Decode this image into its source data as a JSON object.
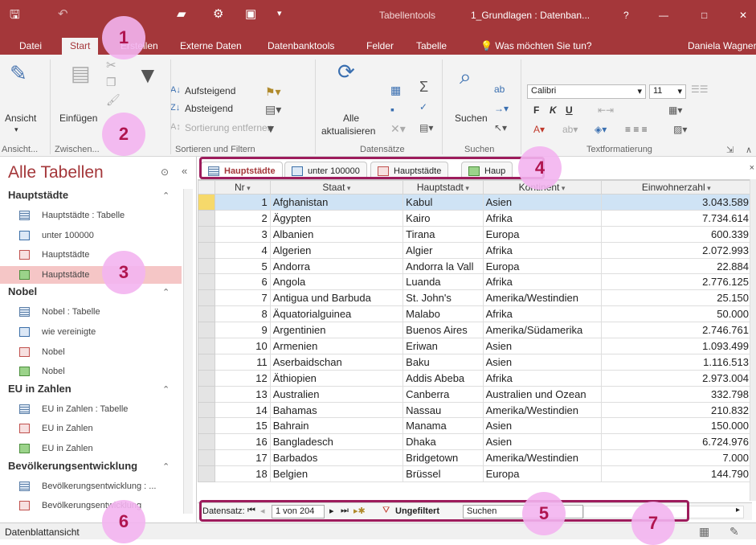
{
  "titlebar": {
    "context_tab": "Tabellentools",
    "doc_title": "1_Grundlagen : Datenban...",
    "help": "?",
    "minimize": "—",
    "maximize": "□",
    "close": "✕"
  },
  "tabs": [
    "Datei",
    "Start",
    "Erstellen",
    "Externe Daten",
    "Datenbanktools",
    "Felder",
    "Tabelle"
  ],
  "tellme": "Was möchten Sie tun?",
  "user": "Daniela Wagner",
  "ribbon": {
    "ansicht": "Ansicht",
    "einfuegen": "Einfügen",
    "aufsteigend": "Aufsteigend",
    "absteigend": "Absteigend",
    "sortierung_entfernen": "Sortierung entfernen",
    "alle": "Alle",
    "aktualisieren": "aktualisieren",
    "suchen": "Suchen",
    "font": "Calibri",
    "font_size": "11",
    "bold": "F",
    "italic": "K",
    "underline": "U",
    "groups": {
      "ansicht": "Ansicht...",
      "zwischen": "Zwischen...",
      "sortieren": "Sortieren und Filtern",
      "datensaetze": "Datensätze",
      "suchen": "Suchen",
      "text": "Textformatierung"
    }
  },
  "nav": {
    "title": "Alle Tabellen",
    "groups": [
      {
        "name": "Hauptstädte",
        "items": [
          {
            "label": "Hauptstädte : Tabelle",
            "icon": "table-icon"
          },
          {
            "label": "unter 100000",
            "icon": "query-icon"
          },
          {
            "label": "Hauptstädte",
            "icon": "form-icon"
          },
          {
            "label": "Hauptstädte",
            "icon": "report-icon",
            "selected": true
          }
        ]
      },
      {
        "name": "Nobel",
        "items": [
          {
            "label": "Nobel : Tabelle",
            "icon": "table-icon"
          },
          {
            "label": "wie vereinigte",
            "icon": "query-icon"
          },
          {
            "label": "Nobel",
            "icon": "form-icon"
          },
          {
            "label": "Nobel",
            "icon": "report-icon"
          }
        ]
      },
      {
        "name": "EU in Zahlen",
        "items": [
          {
            "label": "EU in Zahlen : Tabelle",
            "icon": "table-icon"
          },
          {
            "label": "EU in Zahlen",
            "icon": "form-icon"
          },
          {
            "label": "EU in Zahlen",
            "icon": "report-icon"
          }
        ]
      },
      {
        "name": "Bevölkerungsentwicklung",
        "items": [
          {
            "label": "Bevölkerungsentwicklung : ...",
            "icon": "table-icon"
          },
          {
            "label": "Bevölkerungsentwicklung",
            "icon": "form-icon"
          }
        ]
      }
    ]
  },
  "doctabs": [
    {
      "label": "Hauptstädte",
      "icon": "table-icon",
      "active": true
    },
    {
      "label": "unter 100000",
      "icon": "query-icon"
    },
    {
      "label": "Hauptstädte",
      "icon": "form-icon"
    },
    {
      "label": "Haup",
      "icon": "report-icon"
    }
  ],
  "table": {
    "columns": [
      "Nr",
      "Staat",
      "Hauptstadt",
      "Kontinent",
      "Einwohnerzahl"
    ],
    "rows": [
      [
        "1",
        "Afghanistan",
        "Kabul",
        "Asien",
        "3.043.589"
      ],
      [
        "2",
        "Ägypten",
        "Kairo",
        "Afrika",
        "7.734.614"
      ],
      [
        "3",
        "Albanien",
        "Tirana",
        "Europa",
        "600.339"
      ],
      [
        "4",
        "Algerien",
        "Algier",
        "Afrika",
        "2.072.993"
      ],
      [
        "5",
        "Andorra",
        "Andorra la Vall",
        "Europa",
        "22.884"
      ],
      [
        "6",
        "Angola",
        "Luanda",
        "Afrika",
        "2.776.125"
      ],
      [
        "7",
        "Antigua und Barbuda",
        "St. John's",
        "Amerika/Westindien",
        "25.150"
      ],
      [
        "8",
        "Äquatorialguinea",
        "Malabo",
        "Afrika",
        "50.000"
      ],
      [
        "9",
        "Argentinien",
        "Buenos Aires",
        "Amerika/Südamerika",
        "2.746.761"
      ],
      [
        "10",
        "Armenien",
        "Eriwan",
        "Asien",
        "1.093.499"
      ],
      [
        "11",
        "Aserbaidschan",
        "Baku",
        "Asien",
        "1.116.513"
      ],
      [
        "12",
        "Äthiopien",
        "Addis Abeba",
        "Afrika",
        "2.973.004"
      ],
      [
        "13",
        "Australien",
        "Canberra",
        "Australien und Ozean",
        "332.798"
      ],
      [
        "14",
        "Bahamas",
        "Nassau",
        "Amerika/Westindien",
        "210.832"
      ],
      [
        "15",
        "Bahrain",
        "Manama",
        "Asien",
        "150.000"
      ],
      [
        "16",
        "Bangladesch",
        "Dhaka",
        "Asien",
        "6.724.976"
      ],
      [
        "17",
        "Barbados",
        "Bridgetown",
        "Amerika/Westindien",
        "7.000"
      ],
      [
        "18",
        "Belgien",
        "Brüssel",
        "Europa",
        "144.790"
      ]
    ]
  },
  "recnav": {
    "label": "Datensatz:",
    "position": "1 von 204",
    "filter": "Ungefiltert",
    "search": "Suchen"
  },
  "status": {
    "text": "Datenblattansicht"
  },
  "callouts": [
    "1",
    "2",
    "3",
    "4",
    "5",
    "6",
    "7"
  ],
  "colors": {
    "accent": "#a4373a",
    "callout": "#f3b4f0",
    "callout_text": "#b0154f",
    "highlight": "#9d1c5c"
  }
}
